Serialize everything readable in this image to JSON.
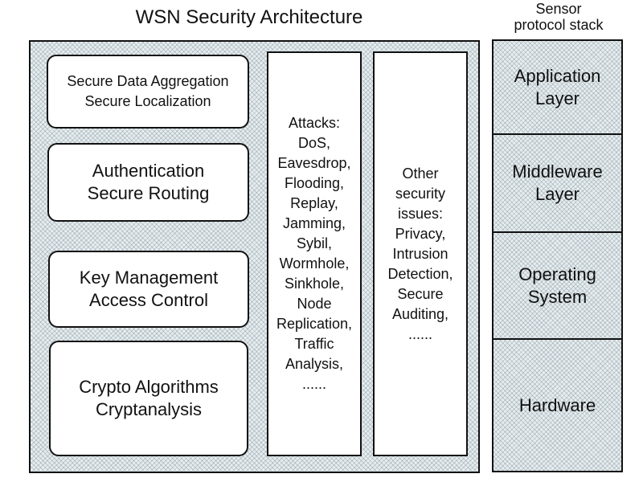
{
  "title": "WSN Security Architecture",
  "stack_title": [
    "Sensor",
    "protocol stack"
  ],
  "left_boxes": [
    {
      "lines": [
        "Secure Data Aggregation",
        "Secure Localization"
      ]
    },
    {
      "lines": [
        "Authentication",
        "Secure Routing"
      ]
    },
    {
      "lines": [
        "Key Management",
        "Access Control"
      ]
    },
    {
      "lines": [
        "Crypto Algorithms",
        "Cryptanalysis"
      ]
    }
  ],
  "attacks": {
    "lines": [
      "Attacks:",
      "DoS,",
      "Eavesdrop,",
      "Flooding,",
      "Replay,",
      "Jamming,",
      "Sybil,",
      "Wormhole,",
      "Sinkhole,",
      "Node",
      "Replication,",
      "Traffic",
      "Analysis,",
      "......"
    ]
  },
  "other_issues": {
    "lines": [
      "Other",
      "security",
      "issues:",
      "Privacy,",
      "Intrusion",
      "Detection,",
      "Secure",
      "Auditing,",
      "......"
    ]
  },
  "protocol_stack": [
    {
      "lines": [
        "Application",
        "Layer"
      ]
    },
    {
      "lines": [
        "Middleware",
        "Layer"
      ]
    },
    {
      "lines": [
        "Operating",
        "System"
      ]
    },
    {
      "lines": [
        "Hardware"
      ]
    }
  ],
  "colors": {
    "hatch_fill": "#e7edef",
    "border": "#111111"
  }
}
